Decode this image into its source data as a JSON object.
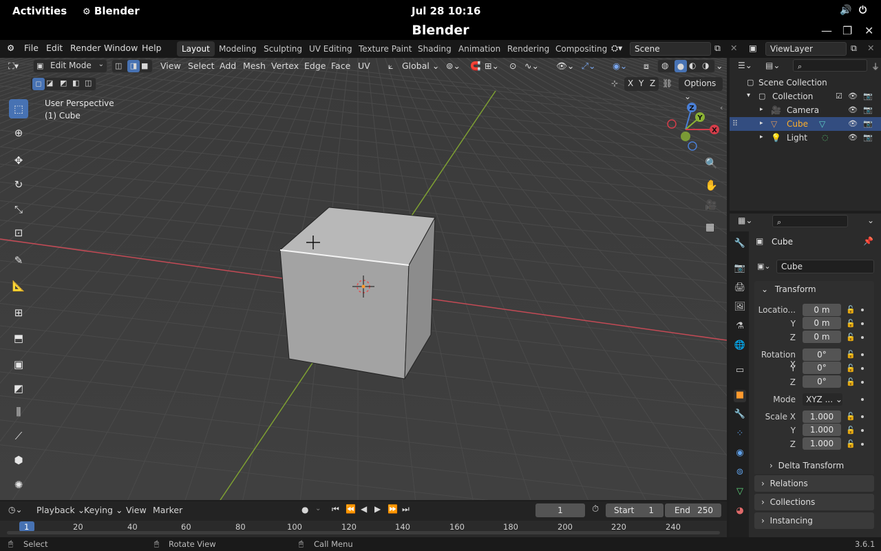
{
  "gnome": {
    "activities": "Activities",
    "app_name": "Blender",
    "clock": "Jul 28  10:16"
  },
  "window": {
    "title": "Blender"
  },
  "menubar": {
    "menus": [
      "File",
      "Edit",
      "Render",
      "Window",
      "Help"
    ],
    "workspaces": [
      "Layout",
      "Modeling",
      "Sculpting",
      "UV Editing",
      "Texture Paint",
      "Shading",
      "Animation",
      "Rendering",
      "Compositing"
    ],
    "active_workspace": "Layout",
    "scene": "Scene",
    "view_layer": "ViewLayer"
  },
  "viewport_header": {
    "mode": "Edit Mode",
    "menus": [
      "View",
      "Select",
      "Add",
      "Mesh",
      "Vertex",
      "Edge",
      "Face",
      "UV"
    ],
    "orientation": "Global",
    "options_label": "Options",
    "axes": [
      "X",
      "Y",
      "Z"
    ]
  },
  "viewport": {
    "perspective_label": "User Perspective",
    "object_label": "(1) Cube"
  },
  "gizmo": {
    "z": "Z",
    "y": "Y",
    "x": "X"
  },
  "outliner": {
    "root": "Scene Collection",
    "collection": "Collection",
    "items": [
      {
        "label": "Camera",
        "icon": "camera-icon"
      },
      {
        "label": "Cube",
        "icon": "mesh-icon",
        "selected": true
      },
      {
        "label": "Light",
        "icon": "light-icon"
      }
    ]
  },
  "properties": {
    "object_name": "Cube",
    "data_name": "Cube",
    "transform_label": "Transform",
    "location": {
      "label": "Locatio...",
      "x": "0 m",
      "y": "0 m",
      "z": "0 m"
    },
    "rotation": {
      "label": "Rotation X",
      "x": "0°",
      "y": "0°",
      "z": "0°"
    },
    "mode_label": "Mode",
    "mode_value": "XYZ ...",
    "scale": {
      "label": "Scale X",
      "x": "1.000",
      "y": "1.000",
      "z": "1.000"
    },
    "axis_y": "Y",
    "axis_z": "Z",
    "sections": [
      "Delta Transform",
      "Relations",
      "Collections",
      "Instancing"
    ]
  },
  "timeline": {
    "menus": [
      "Playback",
      "Keying",
      "View",
      "Marker"
    ],
    "current_frame": "1",
    "start_label": "Start",
    "start": "1",
    "end_label": "End",
    "end": "250",
    "ticks": [
      "1",
      "20",
      "40",
      "60",
      "80",
      "100",
      "120",
      "140",
      "160",
      "180",
      "200",
      "220",
      "240"
    ]
  },
  "status": {
    "select": "Select",
    "rotate": "Rotate View",
    "call_menu": "Call Menu",
    "version": "3.6.1"
  },
  "colors": {
    "accent": "#4772b3",
    "x_axis": "#d43d4a",
    "y_axis": "#8bb334",
    "z_axis": "#4a7fd6",
    "viewport_bg": "#3d3d3d"
  }
}
